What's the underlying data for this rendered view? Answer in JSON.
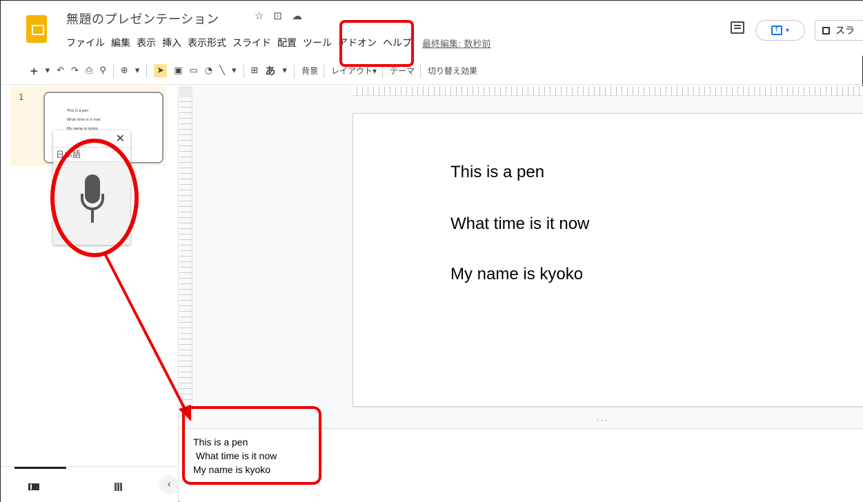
{
  "header": {
    "title": "無題のプレゼンテーション",
    "menu": [
      "ファイル",
      "編集",
      "表示",
      "挿入",
      "表示形式",
      "スライド",
      "配置",
      "ツール",
      "アドオン",
      "ヘルプ"
    ],
    "last_edit": "最終編集: 数秒前",
    "slideshow_label": "スラ"
  },
  "toolbar": {
    "bg_label": "背景",
    "layout_label": "レイアウト▾",
    "theme_label": "テーマ",
    "transition_label": "切り替え効果",
    "input_char": "あ"
  },
  "filmstrip": {
    "slide_number": "1",
    "thumb_lines": [
      "This is a pen",
      "What time is it now",
      "My name is kyoko"
    ]
  },
  "voice_typing": {
    "language": "日本語",
    "close_glyph": "✕"
  },
  "slide": {
    "lines": [
      "This is a pen",
      "What time is it now",
      "My name is kyoko"
    ]
  },
  "notes": {
    "lines": [
      "This is a pen",
      " What time is it now",
      "My name is kyoko"
    ]
  },
  "colors": {
    "accent": "#1a73e8",
    "logo": "#f4b400",
    "annotation": "#e00000"
  }
}
